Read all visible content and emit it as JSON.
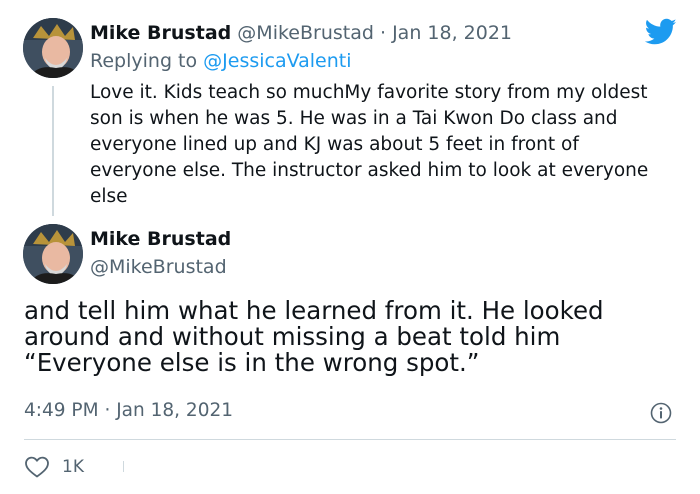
{
  "reply_tweet": {
    "display_name": "Mike Brustad",
    "handle": "@MikeBrustad",
    "separator": "·",
    "date": "Jan 18, 2021",
    "replying_to_prefix": "Replying to ",
    "replying_to_handle": "@JessicaValenti",
    "text": "Love it.  Kids teach so muchMy favorite story from my oldest\nson is when he was 5.  He was in a Tai Kwon Do class and\neveryone lined up and KJ was about 5 feet in front of\neveryone else.  The instructor asked him to look at everyone\nelse"
  },
  "main_tweet": {
    "display_name": "Mike Brustad",
    "handle": "@MikeBrustad",
    "text": "and tell him what he learned from it.  He looked\naround and without missing a beat told him\n“Everyone else is in the wrong spot.”",
    "time": "4:49 PM",
    "separator": "·",
    "date": "Jan 18, 2021"
  },
  "actions": {
    "like_count": "1K"
  },
  "icons": {
    "brand": "twitter-bird-icon",
    "info": "info-icon",
    "like": "heart-icon"
  },
  "colors": {
    "brand_blue": "#1d9bf0",
    "secondary_text": "#536471",
    "divider": "#cfd9de"
  }
}
